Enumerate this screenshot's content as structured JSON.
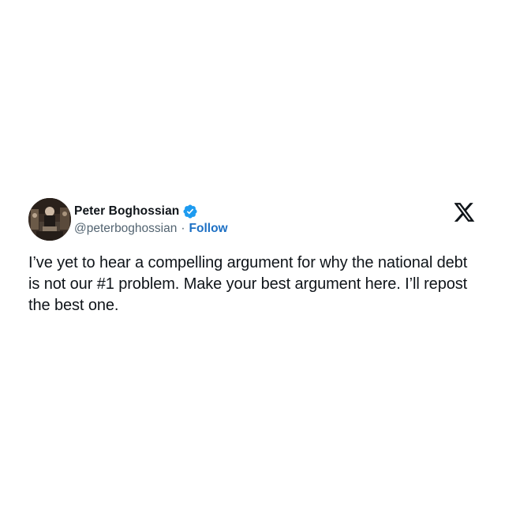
{
  "tweet": {
    "author": {
      "display_name": "Peter Boghossian",
      "handle": "@peterboghossian",
      "verified": true,
      "avatar_icon": "profile-photo"
    },
    "separator": "·",
    "follow_label": "Follow",
    "text": "I’ve yet to hear a compelling argument for why the national debt is not our #1 problem. Make your best argument here. I’ll repost the best one.",
    "platform_icon": "x-logo-icon"
  },
  "colors": {
    "verified_badge": "#1d9bf0",
    "follow_link": "#1d70c4",
    "handle_text": "#536471",
    "body_text": "#0f1419",
    "background": "#ffffff"
  }
}
